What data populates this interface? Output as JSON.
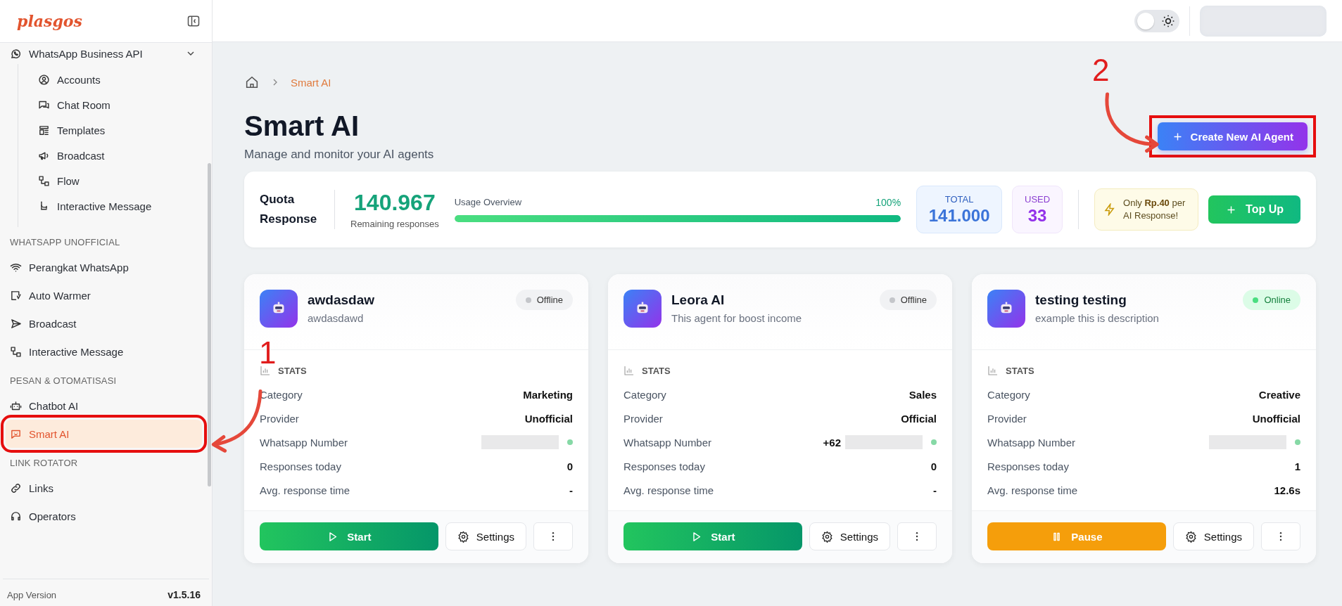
{
  "brand": {
    "name": "plasgos"
  },
  "sidebar": {
    "groups": [
      {
        "items": [
          {
            "label": "WhatsApp Business API",
            "selected": false,
            "expanded": true,
            "children": [
              {
                "label": "Accounts",
                "selected": false
              },
              {
                "label": "Chat Room",
                "selected": false
              },
              {
                "label": "Templates",
                "selected": false
              },
              {
                "label": "Broadcast",
                "selected": false
              },
              {
                "label": "Flow",
                "selected": false
              },
              {
                "label": "Interactive Message",
                "selected": false
              }
            ]
          }
        ]
      },
      {
        "title": "WHATSAPP UNOFFICIAL",
        "items": [
          {
            "label": "Perangkat WhatsApp",
            "selected": false
          },
          {
            "label": "Auto Warmer",
            "selected": false
          },
          {
            "label": "Broadcast",
            "selected": false
          },
          {
            "label": "Interactive Message",
            "selected": false
          }
        ]
      },
      {
        "title": "PESAN & OTOMATISASI",
        "items": [
          {
            "label": "Chatbot AI",
            "selected": false
          },
          {
            "label": "Smart AI",
            "selected": true,
            "highlighted": true
          }
        ]
      },
      {
        "title": "LINK ROTATOR",
        "items": [
          {
            "label": "Links",
            "selected": false
          },
          {
            "label": "Operators",
            "selected": false
          }
        ]
      }
    ],
    "footer": {
      "label": "App Version",
      "version": "v1.5.16"
    }
  },
  "topbar": {
    "theme_toggle": {
      "on": false
    }
  },
  "breadcrumb": [
    "Smart AI"
  ],
  "page": {
    "title": "Smart AI",
    "subtitle": "Manage and monitor your AI agents",
    "create_button": {
      "label": "Create New AI Agent",
      "highlighted": true
    }
  },
  "quota": {
    "title": "Quota Response",
    "remaining": "140.967",
    "remaining_label": "Remaining responses",
    "usage_label": "Usage Overview",
    "level": 1.0,
    "reading": "100%",
    "total": {
      "label": "TOTAL",
      "value": "141.000"
    },
    "used": {
      "label": "USED",
      "value": "33"
    },
    "promo": "Only **Rp.40** per AI Response!",
    "top_up": "Top Up"
  },
  "agents": [
    {
      "name": "awdasdaw",
      "description": "awdasdawd",
      "status": "Offline",
      "online": false,
      "stats_title": "STATS",
      "stats": [
        {
          "kind": "text",
          "label": "Category",
          "value": "Marketing"
        },
        {
          "kind": "text",
          "label": "Provider",
          "value": "Unofficial"
        },
        {
          "kind": "phone",
          "label": "Whatsapp Number",
          "connected": true
        },
        {
          "kind": "text",
          "label": "Responses today",
          "value": "0"
        },
        {
          "kind": "text",
          "label": "Avg. response time",
          "value": "-"
        }
      ],
      "action": {
        "kind": "start",
        "label": "Start"
      },
      "settings": "Settings"
    },
    {
      "name": "Leora AI",
      "description": "This agent for boost income",
      "status": "Offline",
      "online": false,
      "stats_title": "STATS",
      "stats": [
        {
          "kind": "text",
          "label": "Category",
          "value": "Sales"
        },
        {
          "kind": "text",
          "label": "Provider",
          "value": "Official"
        },
        {
          "kind": "phone",
          "label": "Whatsapp Number",
          "prefix": "+62",
          "connected": true
        },
        {
          "kind": "text",
          "label": "Responses today",
          "value": "0"
        },
        {
          "kind": "text",
          "label": "Avg. response time",
          "value": "-"
        }
      ],
      "action": {
        "kind": "start",
        "label": "Start"
      },
      "settings": "Settings"
    },
    {
      "name": "testing testing",
      "description": "example this is description",
      "status": "Online",
      "online": true,
      "stats_title": "STATS",
      "stats": [
        {
          "kind": "text",
          "label": "Category",
          "value": "Creative"
        },
        {
          "kind": "text",
          "label": "Provider",
          "value": "Unofficial"
        },
        {
          "kind": "phone",
          "label": "Whatsapp Number",
          "connected": true
        },
        {
          "kind": "text",
          "label": "Responses today",
          "value": "1"
        },
        {
          "kind": "text",
          "label": "Avg. response time",
          "value": "12.6s"
        }
      ],
      "action": {
        "kind": "pause",
        "label": "Pause"
      },
      "settings": "Settings"
    }
  ],
  "annotations": [
    {
      "label": "1"
    },
    {
      "label": "2"
    }
  ]
}
